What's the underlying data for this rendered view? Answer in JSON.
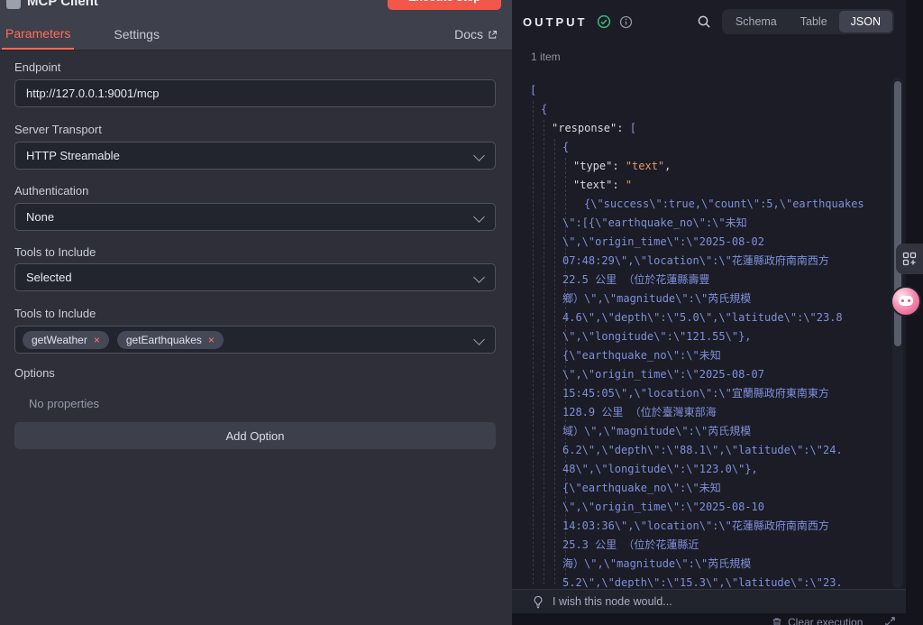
{
  "colors": {
    "accent": "#ff6d5a",
    "success": "#3fb980",
    "assistant_pink": "#e44f7e",
    "execute_red": "#f25749"
  },
  "icons": {
    "close": "×"
  },
  "header": {
    "title": "MCP Client",
    "execute_label": "Execute step",
    "docs_label": "Docs",
    "tabs": [
      {
        "label": "Parameters",
        "active": true
      },
      {
        "label": "Settings",
        "active": false
      }
    ]
  },
  "form": {
    "endpoint": {
      "label": "Endpoint",
      "value": "http://127.0.0.1:9001/mcp"
    },
    "server_transport": {
      "label": "Server Transport",
      "value": "HTTP Streamable"
    },
    "authentication": {
      "label": "Authentication",
      "value": "None"
    },
    "tools_mode": {
      "label": "Tools to Include",
      "value": "Selected"
    },
    "tools_select": {
      "label": "Tools to Include",
      "tags": [
        "getWeather",
        "getEarthquakes"
      ]
    },
    "options": {
      "label": "Options",
      "empty_text": "No properties",
      "add_button": "Add Option"
    }
  },
  "output": {
    "title": "OUTPUT",
    "items_count": "1 item",
    "views": [
      {
        "label": "Schema",
        "active": false
      },
      {
        "label": "Table",
        "active": false
      },
      {
        "label": "JSON",
        "active": true
      }
    ],
    "wish_text": "I wish this node would...",
    "clear_label": "Clear execution",
    "json_lines": [
      {
        "i": 0,
        "s": [
          [
            "p",
            "["
          ]
        ]
      },
      {
        "i": 1,
        "s": [
          [
            "p",
            "{"
          ]
        ]
      },
      {
        "i": 2,
        "s": [
          [
            "k",
            "\"response\""
          ],
          [
            "k",
            ": "
          ],
          [
            "p",
            "["
          ]
        ]
      },
      {
        "i": 3,
        "s": [
          [
            "p",
            "{"
          ]
        ]
      },
      {
        "i": 4,
        "s": [
          [
            "k",
            "\"type\""
          ],
          [
            "k",
            ": "
          ],
          [
            "s",
            "\"text\""
          ],
          [
            "k",
            ","
          ]
        ]
      },
      {
        "i": 4,
        "s": [
          [
            "k",
            "\"text\""
          ],
          [
            "k",
            ": "
          ],
          [
            "s",
            "\""
          ]
        ]
      },
      {
        "i": 5,
        "s": [
          [
            "b",
            "{\\\"success\\\":true,\\\"count\\\":5,\\\"earthquakes"
          ]
        ]
      },
      {
        "i": 3,
        "s": [
          [
            "b",
            "\\\":[{\\\"earthquake_no\\\":\\\"未知"
          ]
        ]
      },
      {
        "i": 3,
        "s": [
          [
            "b",
            "\\\",\\\"origin_time\\\":\\\"2025-08-02"
          ]
        ]
      },
      {
        "i": 3,
        "s": [
          [
            "b",
            "07:48:29\\\",\\\"location\\\":\\\"花蓮縣政府南南西方"
          ]
        ]
      },
      {
        "i": 3,
        "s": [
          [
            "b",
            "22.5 公里 （位於花蓮縣壽豐"
          ]
        ]
      },
      {
        "i": 3,
        "s": [
          [
            "b",
            "鄉）\\\",\\\"magnitude\\\":\\\"芮氏規模"
          ]
        ]
      },
      {
        "i": 3,
        "s": [
          [
            "b",
            "4.6\\\",\\\"depth\\\":\\\"5.0\\\",\\\"latitude\\\":\\\"23.8"
          ]
        ]
      },
      {
        "i": 3,
        "s": [
          [
            "b",
            "\\\",\\\"longitude\\\":\\\"121.55\\\"},"
          ]
        ]
      },
      {
        "i": 3,
        "s": [
          [
            "b",
            "{\\\"earthquake_no\\\":\\\"未知"
          ]
        ]
      },
      {
        "i": 3,
        "s": [
          [
            "b",
            "\\\",\\\"origin_time\\\":\\\"2025-08-07"
          ]
        ]
      },
      {
        "i": 3,
        "s": [
          [
            "b",
            "15:45:05\\\",\\\"location\\\":\\\"宜蘭縣政府東南東方"
          ]
        ]
      },
      {
        "i": 3,
        "s": [
          [
            "b",
            "128.9 公里 （位於臺灣東部海"
          ]
        ]
      },
      {
        "i": 3,
        "s": [
          [
            "b",
            "域）\\\",\\\"magnitude\\\":\\\"芮氏規模"
          ]
        ]
      },
      {
        "i": 3,
        "s": [
          [
            "b",
            "6.2\\\",\\\"depth\\\":\\\"88.1\\\",\\\"latitude\\\":\\\"24."
          ]
        ]
      },
      {
        "i": 3,
        "s": [
          [
            "b",
            "48\\\",\\\"longitude\\\":\\\"123.0\\\"},"
          ]
        ]
      },
      {
        "i": 3,
        "s": [
          [
            "b",
            "{\\\"earthquake_no\\\":\\\"未知"
          ]
        ]
      },
      {
        "i": 3,
        "s": [
          [
            "b",
            "\\\",\\\"origin_time\\\":\\\"2025-08-10"
          ]
        ]
      },
      {
        "i": 3,
        "s": [
          [
            "b",
            "14:03:36\\\",\\\"location\\\":\\\"花蓮縣政府南南西方"
          ]
        ]
      },
      {
        "i": 3,
        "s": [
          [
            "b",
            "25.3 公里 （位於花蓮縣近"
          ]
        ]
      },
      {
        "i": 3,
        "s": [
          [
            "b",
            "海）\\\",\\\"magnitude\\\":\\\"芮氏規模"
          ]
        ]
      },
      {
        "i": 3,
        "s": [
          [
            "b",
            "5.2\\\",\\\"depth\\\":\\\"15.3\\\",\\\"latitude\\\":\\\"23."
          ]
        ]
      }
    ]
  }
}
